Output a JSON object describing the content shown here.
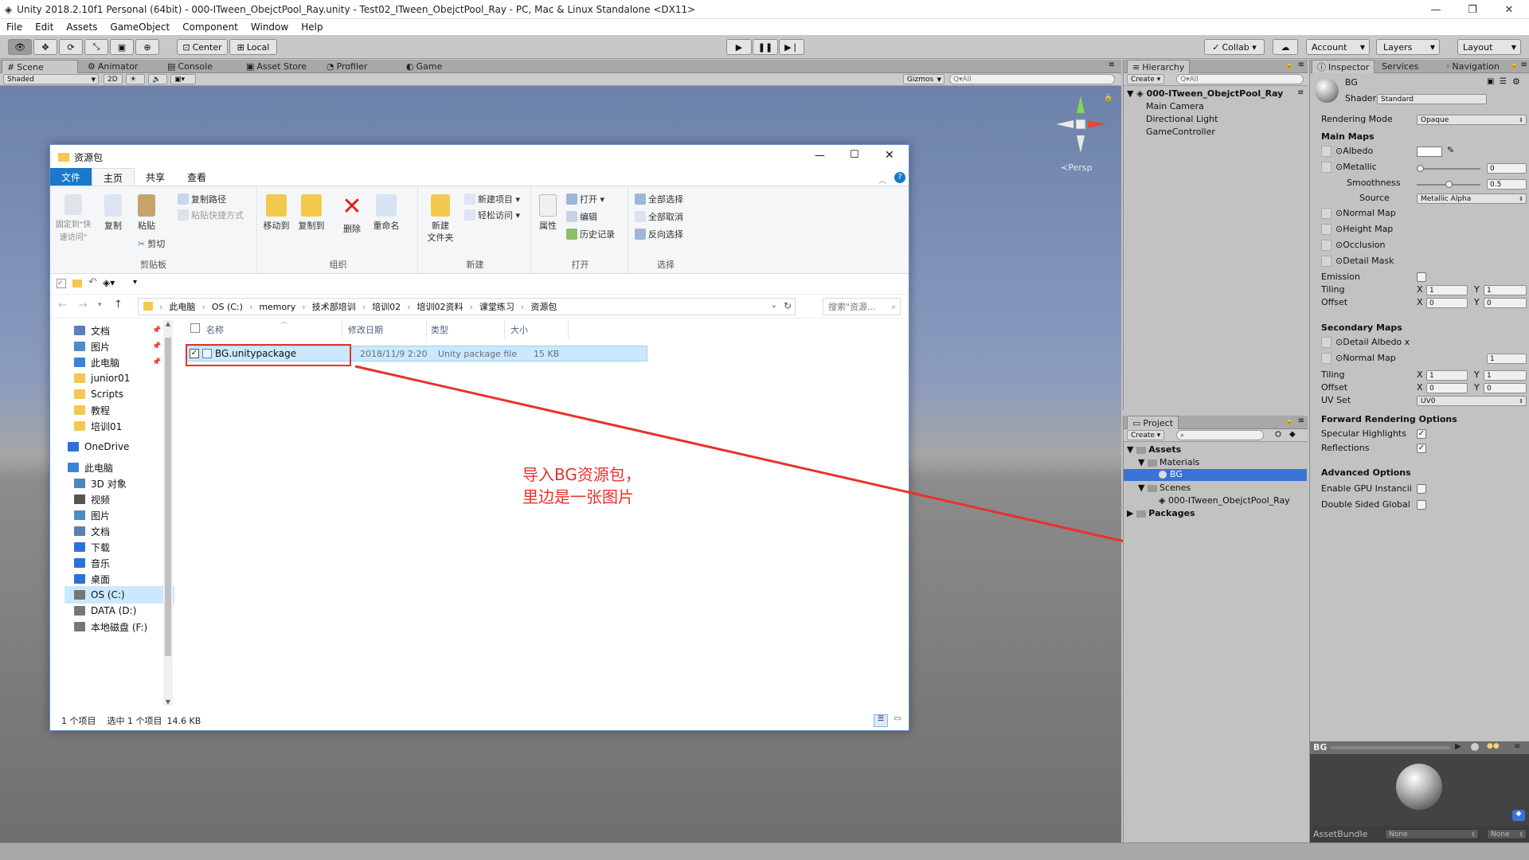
{
  "window": {
    "title": "Unity 2018.2.10f1 Personal (64bit) - 000-ITween_ObejctPool_Ray.unity - Test02_ITween_ObejctPool_Ray - PC, Mac & Linux Standalone <DX11>",
    "controls": [
      "—",
      "❐",
      "✕"
    ]
  },
  "menu": [
    "File",
    "Edit",
    "Assets",
    "GameObject",
    "Component",
    "Window",
    "Help"
  ],
  "toolbar": {
    "pivot": "Center",
    "space": "Local",
    "collab": "Collab ▾",
    "account": "Account",
    "layers": "Layers",
    "layout": "Layout"
  },
  "scene_tabs": [
    "Scene",
    "Animator",
    "Console",
    "Asset Store",
    "Profiler",
    "Game"
  ],
  "scene_bar": {
    "shading": "Shaded",
    "mode2d": "2D",
    "gizmos": "Gizmos",
    "search": "Q▾All"
  },
  "gizmo": {
    "label": "≺Persp"
  },
  "annotation": {
    "line1": "导入BG资源包，",
    "line2": "里边是一张图片",
    "color": "#e8322a"
  },
  "explorer": {
    "title": "资源包",
    "ribbon_tabs": [
      "文件",
      "主页",
      "共享",
      "查看"
    ],
    "groups": {
      "clipboard": "剪贴板",
      "organize": "组织",
      "new": "新建",
      "open": "打开",
      "select": "选择"
    },
    "buttons": {
      "pin": "固定到\"快速访问\"",
      "copy": "复制",
      "paste": "粘贴",
      "copy_path": "复制路径",
      "paste_shortcut": "粘贴快捷方式",
      "cut": "剪切",
      "move_to": "移动到",
      "copy_to": "复制到",
      "delete": "删除",
      "rename": "重命名",
      "new_folder": "新建\n文件夹",
      "new_item": "新建项目 ▾",
      "easy_access": "轻松访问 ▾",
      "properties": "属性",
      "open": "打开 ▾",
      "edit": "编辑",
      "history": "历史记录",
      "select_all": "全部选择",
      "select_none": "全部取消",
      "invert": "反向选择"
    },
    "breadcrumb": [
      "此电脑",
      "OS (C:)",
      "memory",
      "技术部培训",
      "培训02",
      "培训02资料",
      "课堂练习",
      "资源包"
    ],
    "search_placeholder": "搜索\"资源...",
    "nav": [
      {
        "label": "文档",
        "color": "#5b7fb8",
        "pinned": "📌"
      },
      {
        "label": "图片",
        "color": "#4f8ac9",
        "pinned": "📌"
      },
      {
        "label": "此电脑",
        "color": "#3a84d6",
        "pinned": "📌"
      },
      {
        "label": "junior01",
        "color": "#f3c94d"
      },
      {
        "label": "Scripts",
        "color": "#f3c94d"
      },
      {
        "label": "教程",
        "color": "#f3c94d"
      },
      {
        "label": "培训01",
        "color": "#f3c94d"
      },
      {
        "label": "OneDrive",
        "color": "#2a72d8"
      },
      {
        "label": "此电脑",
        "color": "#3a84d6"
      },
      {
        "label": "3D 对象",
        "color": "#4b87c7"
      },
      {
        "label": "视频",
        "color": "#555"
      },
      {
        "label": "图片",
        "color": "#4f8ac9"
      },
      {
        "label": "文档",
        "color": "#5b7fb8"
      },
      {
        "label": "下载",
        "color": "#2a72d8"
      },
      {
        "label": "音乐",
        "color": "#2a72d8"
      },
      {
        "label": "桌面",
        "color": "#2a72d8"
      },
      {
        "label": "OS (C:)",
        "color": "#777"
      },
      {
        "label": "DATA (D:)",
        "color": "#777"
      },
      {
        "label": "本地磁盘 (F:)",
        "color": "#777"
      }
    ],
    "columns": [
      "名称",
      "修改日期",
      "类型",
      "大小"
    ],
    "files": [
      {
        "name": "BG.unitypackage",
        "modified": "2018/11/9 2:20",
        "type": "Unity package file",
        "size": "15 KB"
      }
    ],
    "status": {
      "count": "1 个项目",
      "selected": "选中 1 个项目",
      "size": "14.6 KB"
    }
  },
  "hierarchy": {
    "tab": "Hierarchy",
    "create": "Create ▾",
    "search": "Q▾All",
    "scene": "000-ITween_ObejctPool_Ray",
    "items": [
      "Main Camera",
      "Directional Light",
      "GameController"
    ]
  },
  "project": {
    "tab": "Project",
    "create": "Create ▾",
    "assets": "Assets",
    "materials": "Materials",
    "bg": "BG",
    "scenes": "Scenes",
    "scene_file": "000-ITween_ObejctPool_Ray",
    "packages": "Packages"
  },
  "inspector": {
    "tabs": [
      "Inspector",
      "Services",
      "Navigation"
    ],
    "name": "BG",
    "shader_label": "Shader",
    "shader": "Standard",
    "rendering_mode_label": "Rendering Mode",
    "rendering_mode": "Opaque",
    "main_maps": "Main Maps",
    "albedo": "Albedo",
    "metallic": "Metallic",
    "metallic_value": "0",
    "smoothness": "Smoothness",
    "smoothness_value": "0.5",
    "source": "Source",
    "source_value": "Metallic Alpha",
    "normal_map": "Normal Map",
    "height_map": "Height Map",
    "occlusion": "Occlusion",
    "detail_mask": "Detail Mask",
    "emission": "Emission",
    "tiling": "Tiling",
    "offset": "Offset",
    "x": "X",
    "y": "Y",
    "tiling_x": "1",
    "tiling_y": "1",
    "offset_x": "0",
    "offset_y": "0",
    "secondary_maps": "Secondary Maps",
    "detail_albedo": "Detail Albedo x",
    "normal_map2": "Normal Map",
    "normal_map2_value": "1",
    "sec_tiling_x": "1",
    "sec_tiling_y": "1",
    "sec_offset_x": "0",
    "sec_offset_y": "0",
    "uv_set": "UV Set",
    "uv_set_value": "UV0",
    "forward": "Forward Rendering Options",
    "specular": "Specular Highlights",
    "reflections": "Reflections",
    "advanced": "Advanced Options",
    "gpu_instancing": "Enable GPU Instancii",
    "double_sided": "Double Sided Global",
    "preview_title": "BG",
    "assetbundle_label": "AssetBundle",
    "assetbundle_value": "None",
    "variant_value": "None"
  }
}
